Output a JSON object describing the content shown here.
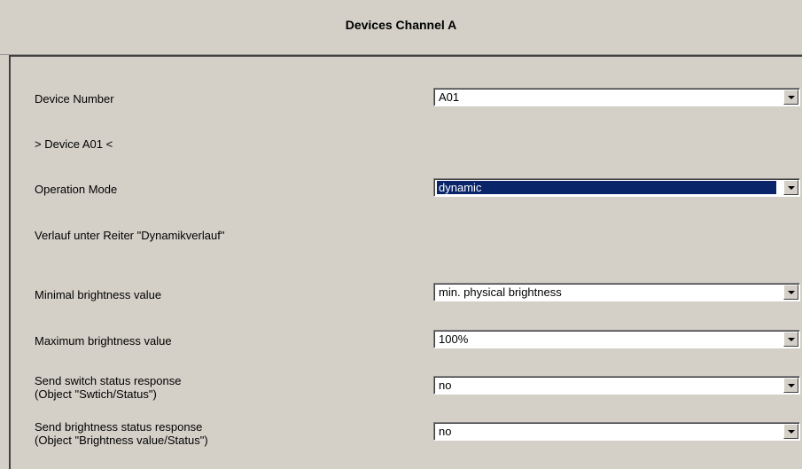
{
  "header": {
    "title": "Devices Channel A"
  },
  "rows": [
    {
      "label": "Device Number",
      "value": "A01"
    },
    {
      "label": "> Device A01 <"
    },
    {
      "label": "Operation Mode",
      "value": "dynamic",
      "selected": true
    },
    {
      "label": "Verlauf unter Reiter \"Dynamikverlauf\""
    },
    {
      "label": "Minimal brightness value",
      "value": "min. physical brightness"
    },
    {
      "label": "Maximum brightness value",
      "value": "100%"
    },
    {
      "label_line1": "Send switch status response",
      "label_line2": "(Object \"Swtich/Status\")",
      "value": "no"
    },
    {
      "label_line1": "Send brightness status response",
      "label_line2": "(Object \"Brightness value/Status\")",
      "value": "no"
    }
  ],
  "icons": {
    "dropdown": "chevron-down-icon"
  },
  "colors": {
    "background": "#d4d0c8",
    "selection": "#0a246a"
  }
}
